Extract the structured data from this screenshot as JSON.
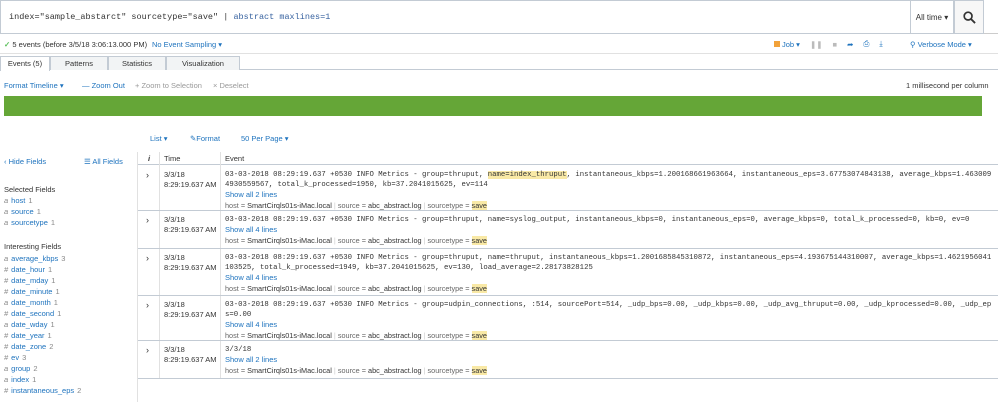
{
  "search": {
    "query_part1": "index=\"sample_abstarct\" sourcetype=\"save\" | ",
    "query_cmd": "abstract maxlines=1",
    "time_range": "All time",
    "time_caret": "▾"
  },
  "status": {
    "check": "✓",
    "events_text": "5 events (before 3/5/18 3:06:13.000 PM)",
    "sampling": "No Event Sampling ▾",
    "job": "Job ▾",
    "verbose": "Verbose Mode ▾"
  },
  "tabs": [
    {
      "label": "Events (5)"
    },
    {
      "label": "Patterns"
    },
    {
      "label": "Statistics"
    },
    {
      "label": "Visualization"
    }
  ],
  "timeline": {
    "format": "Format Timeline ▾",
    "zoom_out": "— Zoom Out",
    "zoom_selection": "+ Zoom to Selection",
    "deselect": "× Deselect",
    "scale": "1 millisecond per column",
    "bar_color": "#65a637"
  },
  "results_toolbar": {
    "list": "List ▾",
    "format": "✎Format",
    "per_page": "50 Per Page ▾"
  },
  "sidebar": {
    "hide_fields": "‹ Hide Fields",
    "all_fields": "☰ All Fields",
    "selected_title": "Selected Fields",
    "selected": [
      {
        "type": "a",
        "name": "host",
        "count": "1"
      },
      {
        "type": "a",
        "name": "source",
        "count": "1"
      },
      {
        "type": "a",
        "name": "sourcetype",
        "count": "1"
      }
    ],
    "interesting_title": "Interesting Fields",
    "interesting": [
      {
        "type": "a",
        "name": "average_kbps",
        "count": "3"
      },
      {
        "type": "#",
        "name": "date_hour",
        "count": "1"
      },
      {
        "type": "#",
        "name": "date_mday",
        "count": "1"
      },
      {
        "type": "#",
        "name": "date_minute",
        "count": "1"
      },
      {
        "type": "a",
        "name": "date_month",
        "count": "1"
      },
      {
        "type": "#",
        "name": "date_second",
        "count": "1"
      },
      {
        "type": "a",
        "name": "date_wday",
        "count": "1"
      },
      {
        "type": "#",
        "name": "date_year",
        "count": "1"
      },
      {
        "type": "#",
        "name": "date_zone",
        "count": "2"
      },
      {
        "type": "#",
        "name": "ev",
        "count": "3"
      },
      {
        "type": "a",
        "name": "group",
        "count": "2"
      },
      {
        "type": "a",
        "name": "index",
        "count": "1"
      },
      {
        "type": "#",
        "name": "instantaneous_eps",
        "count": "2"
      }
    ]
  },
  "table": {
    "col_i": "i",
    "col_time": "Time",
    "col_event": "Event",
    "host_label": "host = ",
    "source_label": "source = ",
    "sourcetype_label": "sourcetype = ",
    "rows": [
      {
        "date": "3/3/18",
        "time": "8:29:19.637 AM",
        "event_pre": "03-03-2018 08:29:19.637 +0530 INFO Metrics - group=thruput, ",
        "event_hl": "name=index_thruput",
        "event_post": ", instantaneous_kbps=1.200168661963664, instantaneous_eps=3.67753074843138, average_kbps=1.4630094930559567, total_k_processed=1950, kb=37.2041015625, ev=114",
        "show_all": "Show all 2 lines",
        "host": "SmartCirqls01s-iMac.local",
        "source": "abc_abstract.log",
        "sourcetype": "save"
      },
      {
        "date": "3/3/18",
        "time": "8:29:19.637 AM",
        "event_pre": "03-03-2018 08:29:19.637 +0530 INFO Metrics - group=thruput, name=syslog_output, instantaneous_kbps=0, instantaneous_eps=0, average_kbps=0, total_k_processed=0, kb=0, ev=0",
        "event_hl": "",
        "event_post": "",
        "show_all": "Show all 4 lines",
        "host": "SmartCirqls01s-iMac.local",
        "source": "abc_abstract.log",
        "sourcetype": "save"
      },
      {
        "date": "3/3/18",
        "time": "8:29:19.637 AM",
        "event_pre": "03-03-2018 08:29:19.637 +0530 INFO Metrics - group=thruput, name=thruput, instantaneous_kbps=1.2001685845310872, instantaneous_eps=4.193675144310007, average_kbps=1.4621956041103525, total_k_processed=1949, kb=37.2041015625, ev=130, load_average=2.28173828125",
        "event_hl": "",
        "event_post": "",
        "show_all": "Show all 4 lines",
        "host": "SmartCirqls01s-iMac.local",
        "source": "abc_abstract.log",
        "sourcetype": "save"
      },
      {
        "date": "3/3/18",
        "time": "8:29:19.637 AM",
        "event_pre": "03-03-2018 08:29:19.637 +0530 INFO Metrics - group=udpin_connections, :514, sourcePort=514, _udp_bps=0.00, _udp_kbps=0.00, _udp_avg_thruput=0.00, _udp_kprocessed=0.00, _udp_eps=0.00",
        "event_hl": "",
        "event_post": "",
        "show_all": "Show all 4 lines",
        "host": "SmartCirqls01s-iMac.local",
        "source": "abc_abstract.log",
        "sourcetype": "save"
      },
      {
        "date": "3/3/18",
        "time": "8:29:19.637 AM",
        "event_pre": "3/3/18",
        "event_hl": "",
        "event_post": "",
        "show_all": "Show all 2 lines",
        "host": "SmartCirqls01s-iMac.local",
        "source": "abc_abstract.log",
        "sourcetype": "save"
      }
    ]
  }
}
